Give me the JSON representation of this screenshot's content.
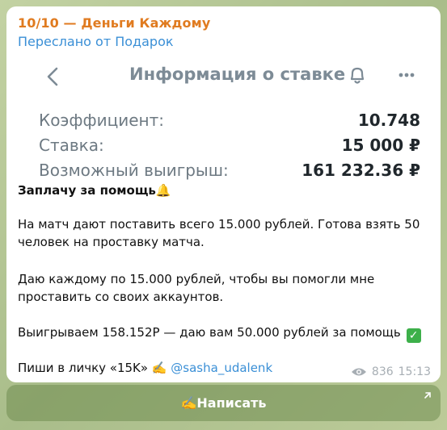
{
  "message": {
    "channel": "10/10 — Деньги Каждому",
    "forwarded_from": "Переслано от Подарок",
    "title": "Заплачу за помощь🔔",
    "para1_line1": "На матч дают поставить всего 15.000 рублей. Готова взять 50",
    "para1_line2": "человек на проставку матча.",
    "para2_line1": "Даю каждому по 15.000 рублей, чтобы вы помогли мне",
    "para2_line2": "проставить со своих аккаунтов.",
    "para3": "Выигрываем 158.152Р — даю вам 50.000 рублей за помощь",
    "para4_prefix": "Пиши в личку «15K» ✍️",
    "mention": "@sasha_udalenk",
    "views": "836",
    "time": "15:13"
  },
  "bet_screenshot": {
    "title": "Информация о ставке",
    "rows": [
      {
        "label": "Коэффициент:",
        "value": "10.748"
      },
      {
        "label": "Ставка:",
        "value": "15 000 ₽"
      },
      {
        "label": "Возможный выигрыш:",
        "value": "161 232.36 ₽"
      }
    ]
  },
  "action_button": {
    "label": "✍️Написать"
  },
  "icons": {
    "back": "chevron-left-icon",
    "bell": "bell-icon",
    "more": "more-horizontal-icon",
    "views": "eye-icon",
    "external": "arrow-up-right-icon",
    "check": "check-mark-icon"
  },
  "colors": {
    "channel_name": "#e07b20",
    "link": "#3a8fd6",
    "background": "#b7c79a"
  }
}
